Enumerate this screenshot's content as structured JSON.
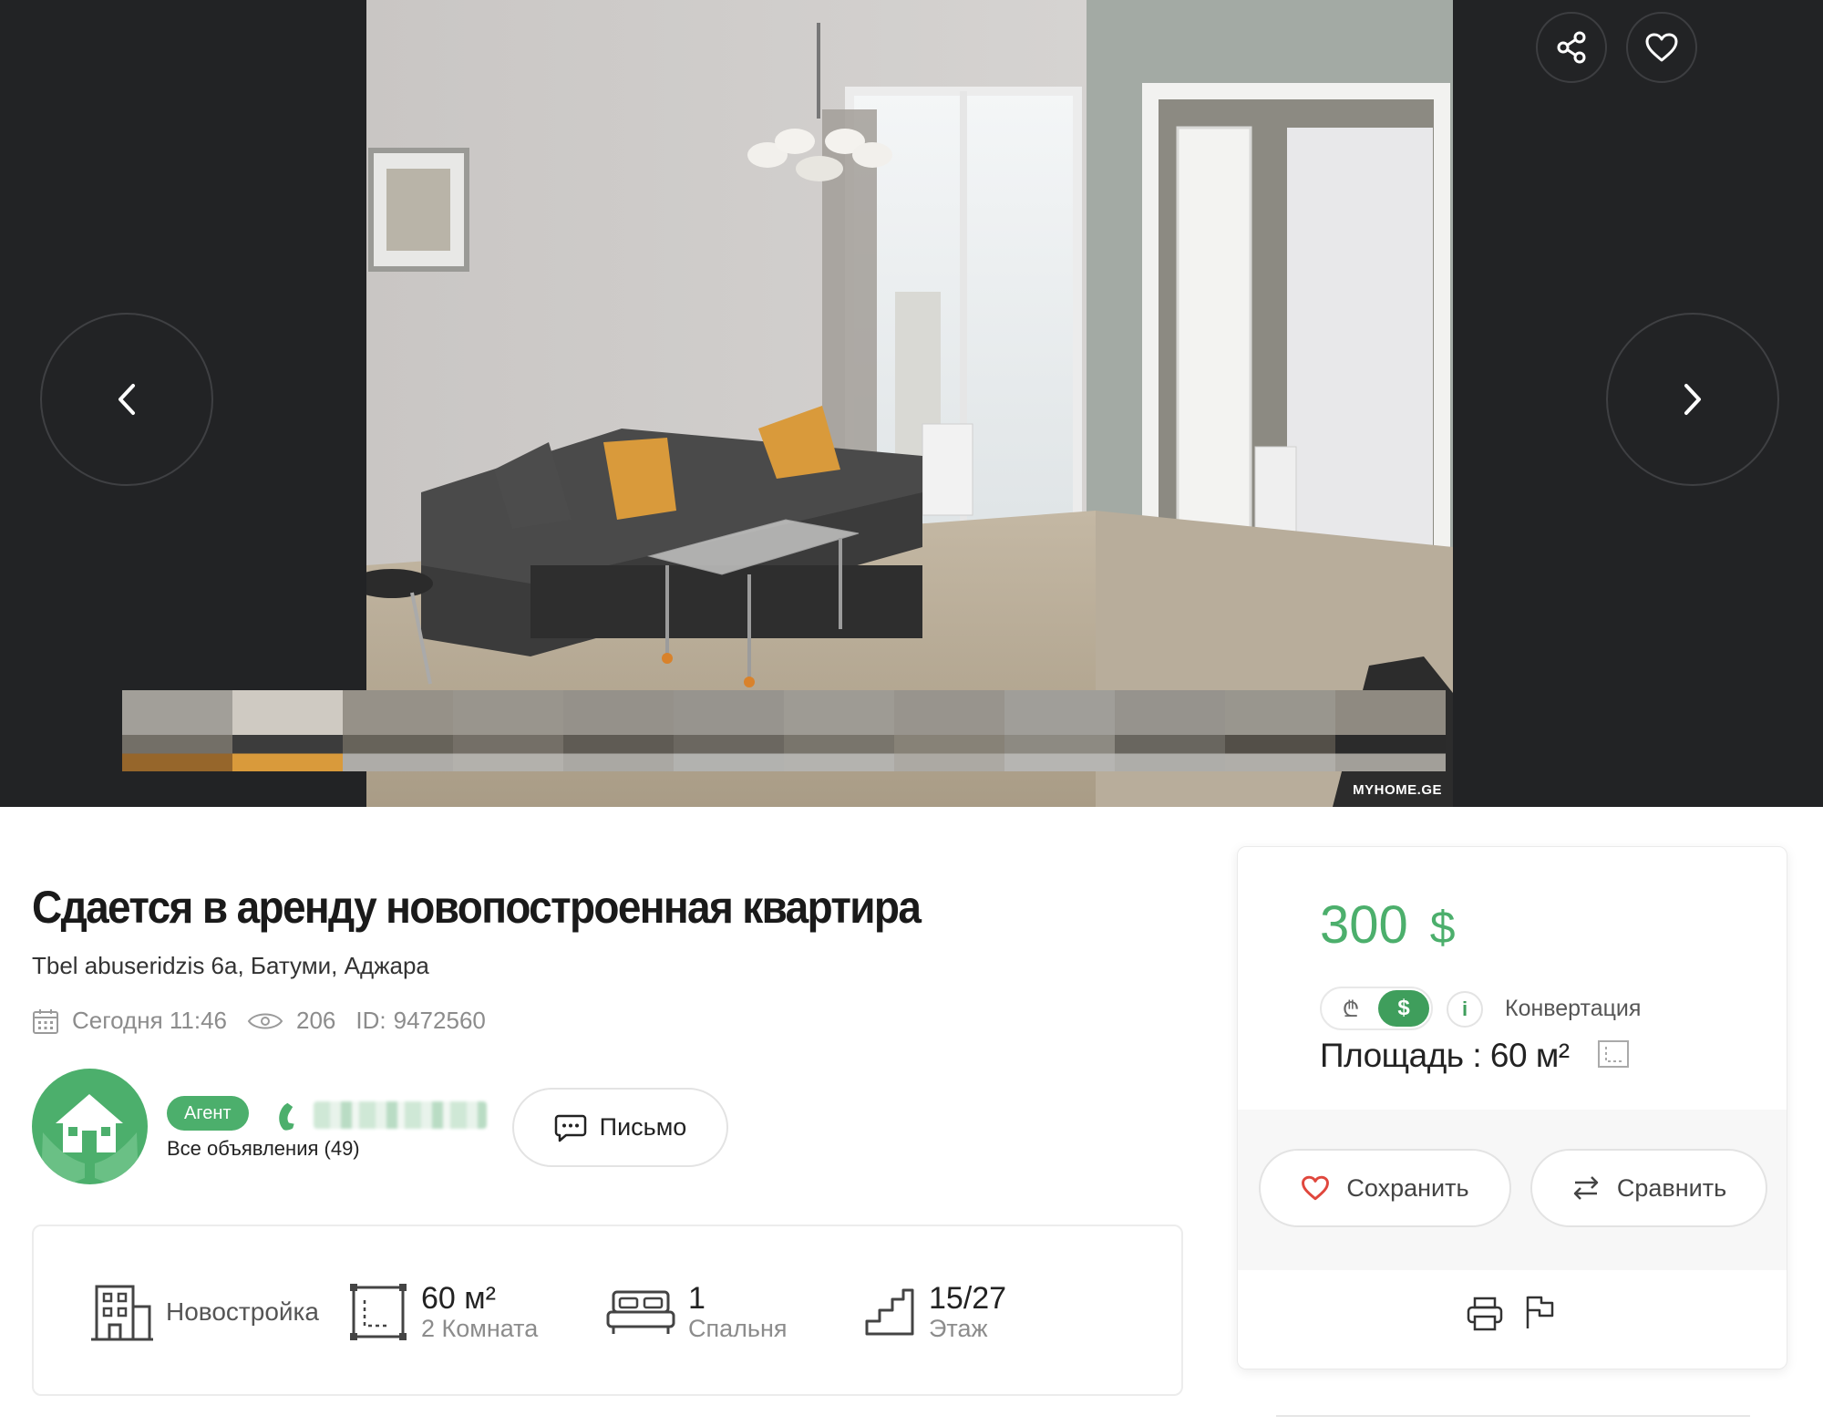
{
  "gallery": {
    "watermark": "MYHOME.GE",
    "thumbnail_count": 12,
    "active_thumbnail": 2
  },
  "listing": {
    "title": "Сдается в аренду новопостроенная квартира",
    "address": "Tbel abuseridzis 6a, Батуми, Аджара",
    "date": "Сегодня 11:46",
    "views": "206",
    "id_label": "ID:",
    "id_value": "9472560"
  },
  "agent": {
    "badge": "Агент",
    "all_ads": "Все объявления (49)",
    "letter_button": "Письмо"
  },
  "features": {
    "type_label": "Новостройка",
    "area_value": "60 м²",
    "rooms": "2 Комната",
    "bedrooms_value": "1",
    "bedrooms_label": "Спальня",
    "floor_value": "15/27",
    "floor_label": "Этаж"
  },
  "price_card": {
    "price": "300",
    "currency_symbol": "$",
    "lari_symbol": "₾",
    "usd_symbol": "$",
    "info_symbol": "i",
    "conversion_label": "Конвертация",
    "area_text": "Площадь : 60 м²",
    "save_button": "Сохранить",
    "compare_button": "Сравнить"
  },
  "colors": {
    "accent_green": "#4caf6c",
    "dark_bg": "#222325",
    "heart_red": "#e0473d"
  }
}
